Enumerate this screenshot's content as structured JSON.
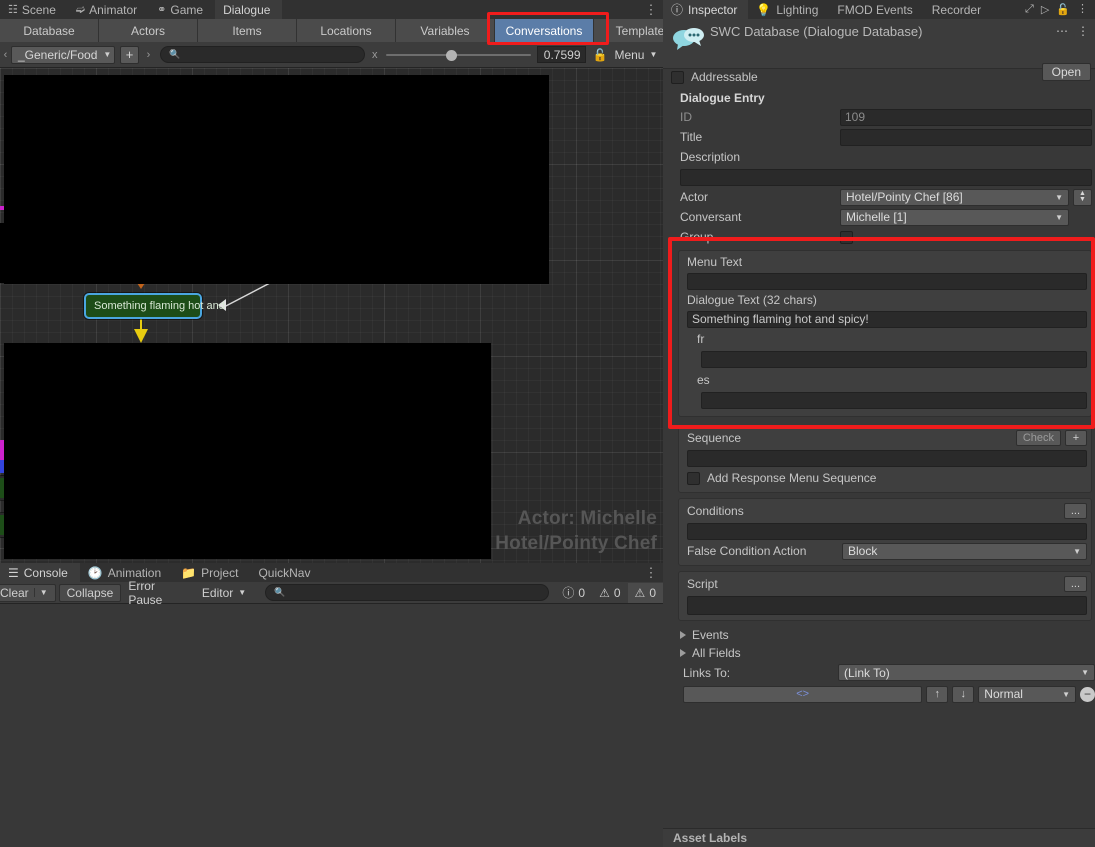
{
  "window_tabs": [
    {
      "label": "Scene",
      "icon": "grid-icon",
      "active": false
    },
    {
      "label": "Animator",
      "icon": "animator-icon",
      "active": false
    },
    {
      "label": "Game",
      "icon": "gamepad-icon",
      "active": false
    },
    {
      "label": "Dialogue",
      "icon": "",
      "active": true
    }
  ],
  "database_tabs": [
    {
      "label": "Database",
      "selected": false
    },
    {
      "label": "Actors",
      "selected": false
    },
    {
      "label": "Items",
      "selected": false
    },
    {
      "label": "Locations",
      "selected": false
    },
    {
      "label": "Variables",
      "selected": false
    },
    {
      "label": "Conversations",
      "selected": true
    },
    {
      "label": "Templates",
      "selected": false
    }
  ],
  "dialogue_toolbar": {
    "conversation_popup": "_Generic/Food",
    "add_label": "+",
    "search_value": "",
    "search_placeholder": "",
    "clear_label": "x",
    "zoom_value": "0.7599",
    "lock_icon": "unlock-icon",
    "menu_label": "Menu"
  },
  "canvas": {
    "node_label": "Something flaming hot and",
    "watermark_line1": "Actor: Michelle",
    "watermark_line2": "Hotel/Pointy Chef"
  },
  "bottom_tabs": [
    {
      "label": "Console",
      "icon": "console-icon",
      "active": true
    },
    {
      "label": "Animation",
      "icon": "clock-icon",
      "active": false
    },
    {
      "label": "Project",
      "icon": "folder-icon",
      "active": false
    },
    {
      "label": "QuickNav",
      "icon": "",
      "active": false
    }
  ],
  "console_bar": {
    "clear_label": "Clear",
    "collapse_label": "Collapse",
    "error_pause_label": "Error Pause",
    "editor_label": "Editor",
    "search_value": "",
    "log_count": "0",
    "warning_count": "0",
    "error_count": "0"
  },
  "inspector_tabs": [
    {
      "label": "Inspector",
      "icon": "info-icon",
      "active": true
    },
    {
      "label": "Lighting",
      "icon": "bulb-icon",
      "active": false
    },
    {
      "label": "FMOD Events",
      "icon": "",
      "active": false
    },
    {
      "label": "Recorder",
      "icon": "",
      "active": false
    }
  ],
  "inspector_header": {
    "asset_icon": "dialogue-bubbles-icon",
    "title": "SWC Database (Dialogue Database)",
    "open_label": "Open",
    "addressable_label": "Addressable"
  },
  "dialogue_entry": {
    "section_title": "Dialogue Entry",
    "id_label": "ID",
    "id_value": "109",
    "title_label": "Title",
    "title_value": "",
    "description_label": "Description",
    "description_value": "",
    "actor_label": "Actor",
    "actor_value": "Hotel/Pointy Chef [86]",
    "conversant_label": "Conversant",
    "conversant_value": "Michelle [1]",
    "group_label": "Group",
    "menu_text_label": "Menu Text",
    "menu_text_value": "",
    "dialogue_text_label": "Dialogue Text (32 chars)",
    "dialogue_text_value": "Something flaming hot and spicy!",
    "localizations": [
      {
        "code": "fr",
        "value": ""
      },
      {
        "code": "es",
        "value": ""
      }
    ]
  },
  "sequence": {
    "label": "Sequence",
    "check_label": "Check",
    "add_label": "+",
    "value": "",
    "add_response_menu_label": "Add Response Menu Sequence"
  },
  "conditions": {
    "label": "Conditions",
    "more_label": "...",
    "value": "",
    "false_action_label": "False Condition Action",
    "false_action_value": "Block"
  },
  "script": {
    "label": "Script",
    "more_label": "...",
    "value": ""
  },
  "foldouts": [
    {
      "label": "Events"
    },
    {
      "label": "All Fields"
    }
  ],
  "links": {
    "links_to_label": "Links To:",
    "links_to_value": "(Link To)",
    "link_entry_label": "<>",
    "up_label": "↑",
    "down_label": "↓",
    "priority_value": "Normal",
    "remove_label": "−"
  },
  "asset_labels": {
    "label": "Asset Labels"
  },
  "colors": {
    "accent_selected_tab": "#5b7da8",
    "highlight_red": "#f01c1c",
    "node_green": "#1d4d18",
    "node_outline_blue": "#4aa6e0",
    "link_blue": "#7b8fd8",
    "panel_bg": "#383838"
  }
}
